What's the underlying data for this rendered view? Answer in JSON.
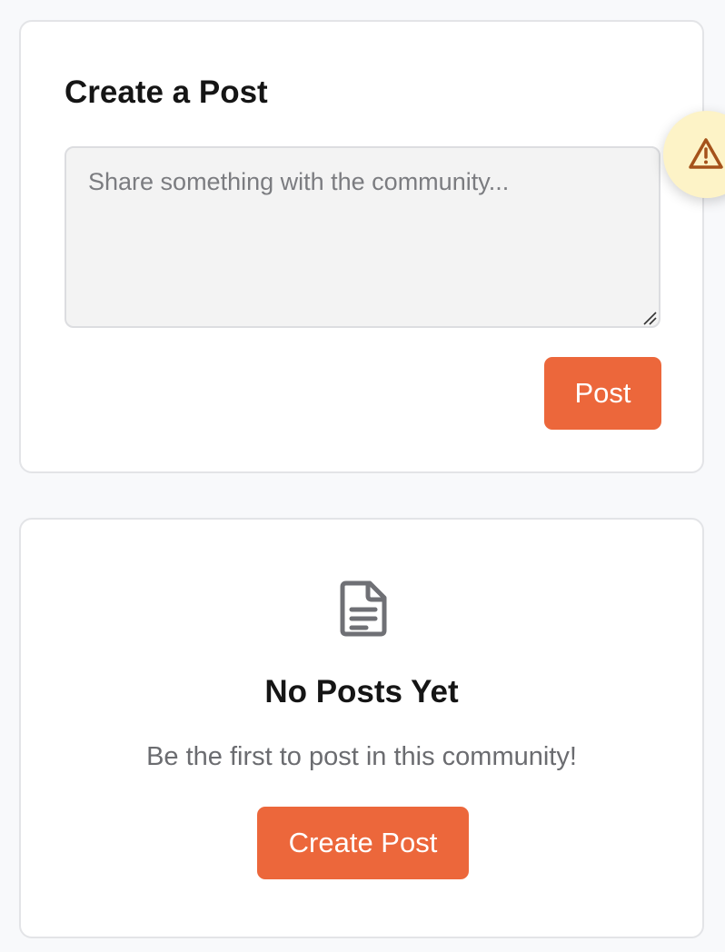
{
  "compose": {
    "title": "Create a Post",
    "input_value": "",
    "input_placeholder": "Share something with the community...",
    "post_button": "Post"
  },
  "empty_state": {
    "icon": "document-icon",
    "title": "No Posts Yet",
    "subtitle": "Be the first to post in this community!",
    "create_button": "Create Post"
  },
  "warning_button": {
    "icon": "warning-icon"
  },
  "colors": {
    "accent": "#ec673b",
    "page_bg": "#f8f9fb",
    "warning_bg": "#fdf3c7",
    "warning_icon": "#a5521a"
  }
}
